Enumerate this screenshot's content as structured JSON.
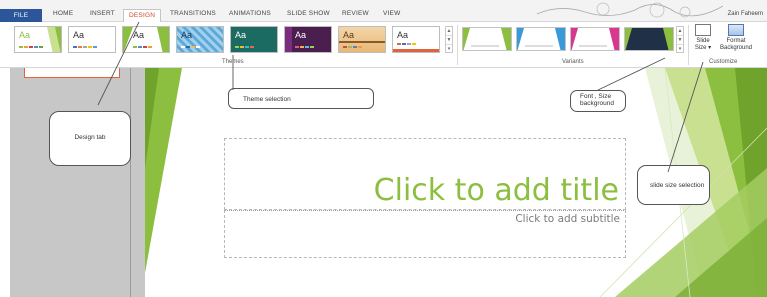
{
  "menu": {
    "tabs": [
      "FILE",
      "HOME",
      "INSERT",
      "DESIGN",
      "TRANSITIONS",
      "ANIMATIONS",
      "SLIDE SHOW",
      "REVIEW",
      "VIEW"
    ],
    "active_tab": "DESIGN",
    "user_name": "Zain Faheem"
  },
  "ribbon": {
    "themes": {
      "group_label": "Themes",
      "thumbnail_label": "Aa"
    },
    "variants": {
      "group_label": "Variants"
    },
    "customize": {
      "group_label": "Customize",
      "slide_size_label": "Slide Size",
      "slide_size_line1": "Slide",
      "slide_size_line2": "Size ▾",
      "format_background_line1": "Format",
      "format_background_line2": "Background"
    }
  },
  "slide": {
    "title_placeholder": "Click to add title",
    "subtitle_placeholder": "Click to add subtitle"
  },
  "callouts": {
    "theme_selection": "Theme selection",
    "design_tab": "Design tab",
    "font_size_background_line1": "Font , Size",
    "font_size_background_line2": "background",
    "slide_size_selection": "slide size selection"
  },
  "colors": {
    "accent_green": "#8cbf3f",
    "file_tab_blue": "#2b579a",
    "active_tab_orange": "#d24726"
  }
}
